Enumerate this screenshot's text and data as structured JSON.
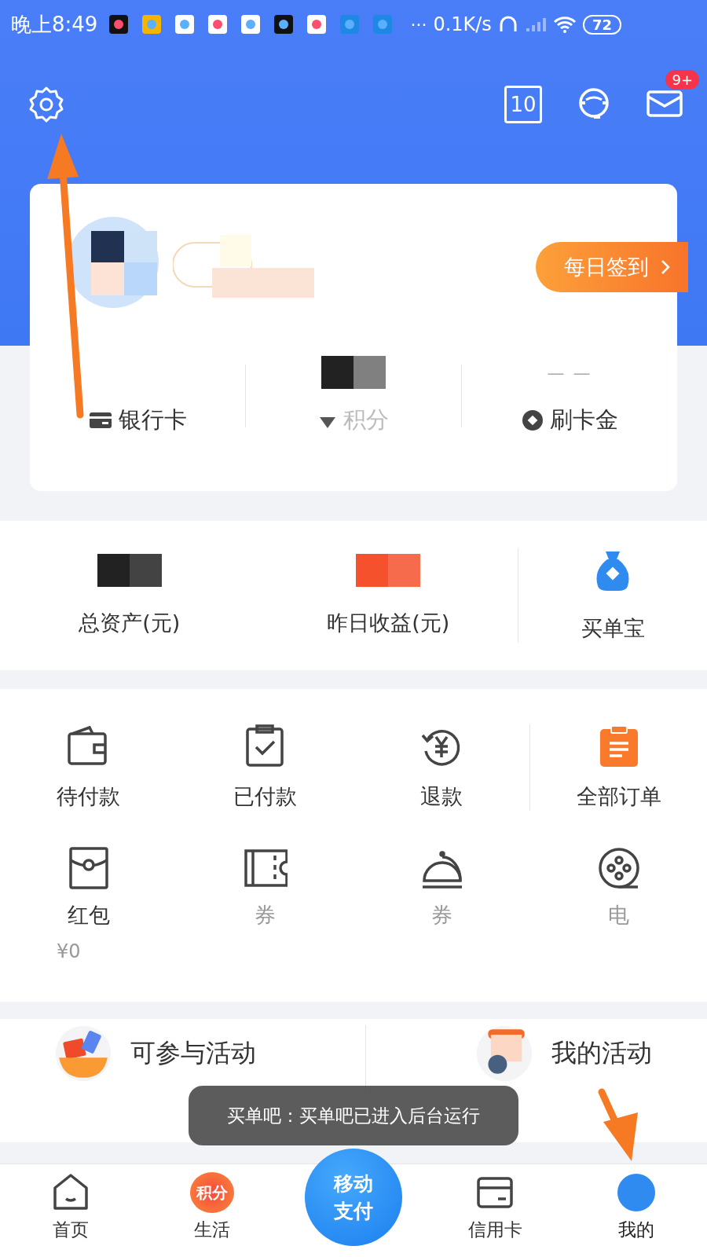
{
  "status_bar": {
    "time": "晚上8:49",
    "more": "···",
    "speed": "0.1K/s",
    "battery": "72"
  },
  "header": {
    "calendar_day": "10",
    "mail_badge": "9+"
  },
  "profile": {
    "checkin": "每日签到"
  },
  "card_stats": [
    {
      "kind": "bank",
      "label": "银行卡"
    },
    {
      "kind": "points",
      "label": "积分"
    },
    {
      "kind": "cashback",
      "label": "刷卡金",
      "value": "— —"
    }
  ],
  "assets": [
    {
      "label": "总资产(元)",
      "color": "#222222"
    },
    {
      "label": "昨日收益(元)",
      "color": "#f4512c"
    }
  ],
  "assets_shortcut": {
    "label": "买单宝"
  },
  "orders": [
    {
      "kind": "wallet",
      "label": "待付款"
    },
    {
      "kind": "clipboard",
      "label": "已付款"
    },
    {
      "kind": "refund",
      "label": "退款"
    }
  ],
  "all_orders": {
    "label": "全部订单"
  },
  "benefits": [
    {
      "kind": "envelope",
      "label": "红包",
      "amount": "¥0"
    },
    {
      "kind": "ticket",
      "label": "券"
    },
    {
      "kind": "cloche",
      "label": "券"
    },
    {
      "kind": "film",
      "label": "电"
    }
  ],
  "activities": [
    {
      "kind": "available",
      "label": "可参与活动"
    },
    {
      "kind": "mine",
      "label": "我的活动"
    }
  ],
  "toast": "买单吧：买单吧已进入后台运行",
  "tabs": [
    {
      "kind": "home",
      "label": "首页",
      "selected": false
    },
    {
      "kind": "life",
      "label": "生活",
      "badge": "积分",
      "selected": false
    },
    {
      "kind": "pay",
      "lines": [
        "移动",
        "支付"
      ],
      "selected": false
    },
    {
      "kind": "card",
      "label": "信用卡",
      "selected": false
    },
    {
      "kind": "profile",
      "label": "我的",
      "selected": true
    }
  ]
}
